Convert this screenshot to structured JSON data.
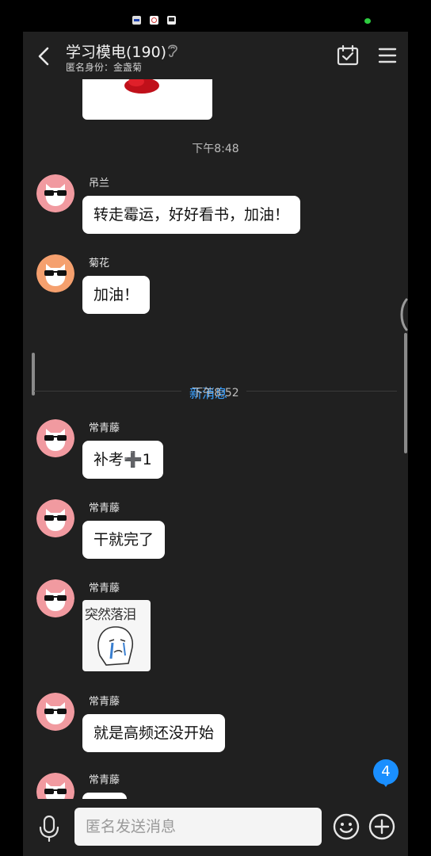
{
  "header": {
    "title": "学习模电(190)",
    "subtitle": "匿名身份：金盏菊"
  },
  "messages": {
    "time_1": "下午8:48",
    "m1": {
      "sender": "吊兰",
      "text": "转走霉运，好好看书，加油！"
    },
    "m2": {
      "sender": "菊花",
      "text": "加油！"
    },
    "new_messages_label": "新消息",
    "time_2": "下午8:52",
    "m3": {
      "sender": "常青藤",
      "text": "补考➕1"
    },
    "m4": {
      "sender": "常青藤",
      "text": "干就完了"
    },
    "m5": {
      "sender": "常青藤",
      "sticker_text": "突然落泪"
    },
    "m6": {
      "sender": "常青藤",
      "text": "就是高频还没开始"
    },
    "m7": {
      "sender": "常青藤"
    }
  },
  "unread_badge": "4",
  "input_bar": {
    "placeholder": "匿名发送消息"
  },
  "colors": {
    "background": "#202020",
    "bubble": "#ffffff",
    "accent": "#1a8fff",
    "new_message_label": "#3aa0ff",
    "avatar_pink": "#f19aa0",
    "avatar_orange": "#f5a06e"
  },
  "icons": {
    "back": "chevron-left-icon",
    "ear": "ear-icon",
    "calendar": "calendar-check-icon",
    "menu": "hamburger-menu-icon",
    "mic": "microphone-icon",
    "emoji": "smiley-icon",
    "plus": "plus-circle-icon"
  }
}
